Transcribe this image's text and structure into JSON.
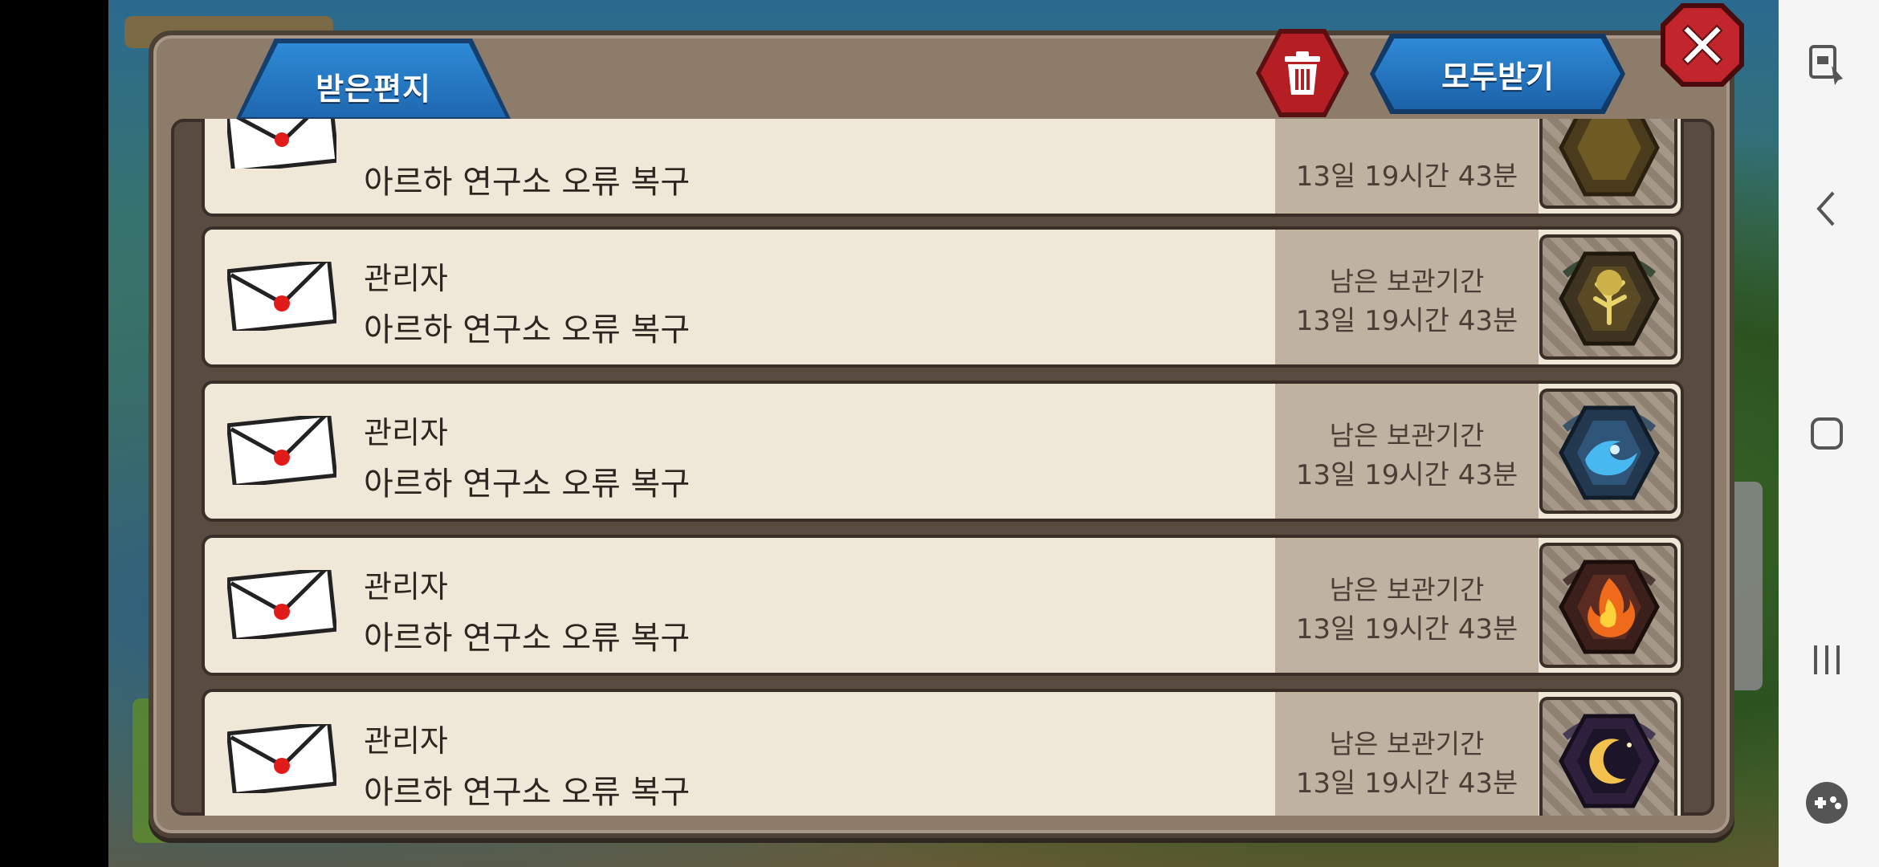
{
  "dialog": {
    "tab_label": "받은편지",
    "receive_all_label": "모두받기",
    "trash_icon": "trash-icon",
    "close_icon": "close-icon"
  },
  "mails": [
    {
      "sender": "",
      "subject": "아르하 연구소 오류 복구",
      "expire_label": "",
      "expire_time": "13일 19시간 43분",
      "reward": "tree-emblem",
      "partial": true
    },
    {
      "sender": "관리자",
      "subject": "아르하 연구소 오류 복구",
      "expire_label": "남은 보관기간",
      "expire_time": "13일 19시간 43분",
      "reward": "tree-emblem"
    },
    {
      "sender": "관리자",
      "subject": "아르하 연구소 오류 복구",
      "expire_label": "남은 보관기간",
      "expire_time": "13일 19시간 43분",
      "reward": "water-emblem"
    },
    {
      "sender": "관리자",
      "subject": "아르하 연구소 오류 복구",
      "expire_label": "남은 보관기간",
      "expire_time": "13일 19시간 43분",
      "reward": "fire-emblem"
    },
    {
      "sender": "관리자",
      "subject": "아르하 연구소 오류 복구",
      "expire_label": "남은 보관기간",
      "expire_time": "13일 19시간 43분",
      "reward": "moon-emblem"
    }
  ],
  "colors": {
    "tree": "#b9a23a",
    "water": "#3fa9e6",
    "fire": "#f06a1c",
    "moon": "#f2c14e"
  },
  "nav": [
    "screen-lock-icon",
    "back-icon",
    "home-icon",
    "recents-icon",
    "game-tools-icon"
  ]
}
